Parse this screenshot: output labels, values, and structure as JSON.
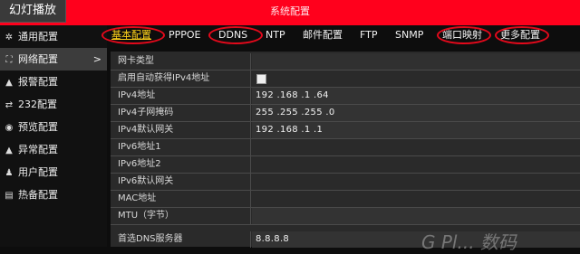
{
  "slideshow_label": "幻灯播放",
  "window_title": "系统配置",
  "sidebar": {
    "items": [
      {
        "icon": "gear-icon",
        "glyph": "✲",
        "label": "通用配置"
      },
      {
        "icon": "network-icon",
        "glyph": "⛶",
        "label": "网络配置",
        "active": true
      },
      {
        "icon": "alarm-icon",
        "glyph": "▲",
        "label": "报警配置"
      },
      {
        "icon": "serial-icon",
        "glyph": "⇄",
        "label": "232配置"
      },
      {
        "icon": "preview-icon",
        "glyph": "◉",
        "label": "预览配置"
      },
      {
        "icon": "warning-icon",
        "glyph": "▲",
        "label": "异常配置"
      },
      {
        "icon": "user-icon",
        "glyph": "♟",
        "label": "用户配置"
      },
      {
        "icon": "hot-spare-icon",
        "glyph": "▤",
        "label": "热备配置"
      }
    ]
  },
  "tabs": [
    {
      "label": "基本配置",
      "active": true
    },
    {
      "label": "PPPOE"
    },
    {
      "label": "DDNS"
    },
    {
      "label": "NTP"
    },
    {
      "label": "邮件配置"
    },
    {
      "label": "FTP"
    },
    {
      "label": "SNMP"
    },
    {
      "label": "端口映射"
    },
    {
      "label": "更多配置"
    }
  ],
  "form": {
    "nic_type": {
      "label": "网卡类型",
      "value": ""
    },
    "dhcp": {
      "label": "启用自动获得IPv4地址",
      "checked": false
    },
    "ipv4_address": {
      "label": "IPv4地址",
      "value": "192 .168 .1   .64"
    },
    "ipv4_mask": {
      "label": "IPv4子网掩码",
      "value": "255 .255 .255 .0"
    },
    "ipv4_gateway": {
      "label": "IPv4默认网关",
      "value": "192 .168 .1   .1"
    },
    "ipv6_address1": {
      "label": "IPv6地址1",
      "value": ""
    },
    "ipv6_address2": {
      "label": "IPv6地址2",
      "value": ""
    },
    "ipv6_gateway": {
      "label": "IPv6默认网关",
      "value": ""
    },
    "mac": {
      "label": "MAC地址",
      "value": ""
    },
    "mtu": {
      "label": "MTU（字节）",
      "value": ""
    },
    "dns": {
      "label": "首选DNS服务器",
      "value": "8.8.8.8"
    }
  },
  "watermark": "G  Pl...  数码"
}
